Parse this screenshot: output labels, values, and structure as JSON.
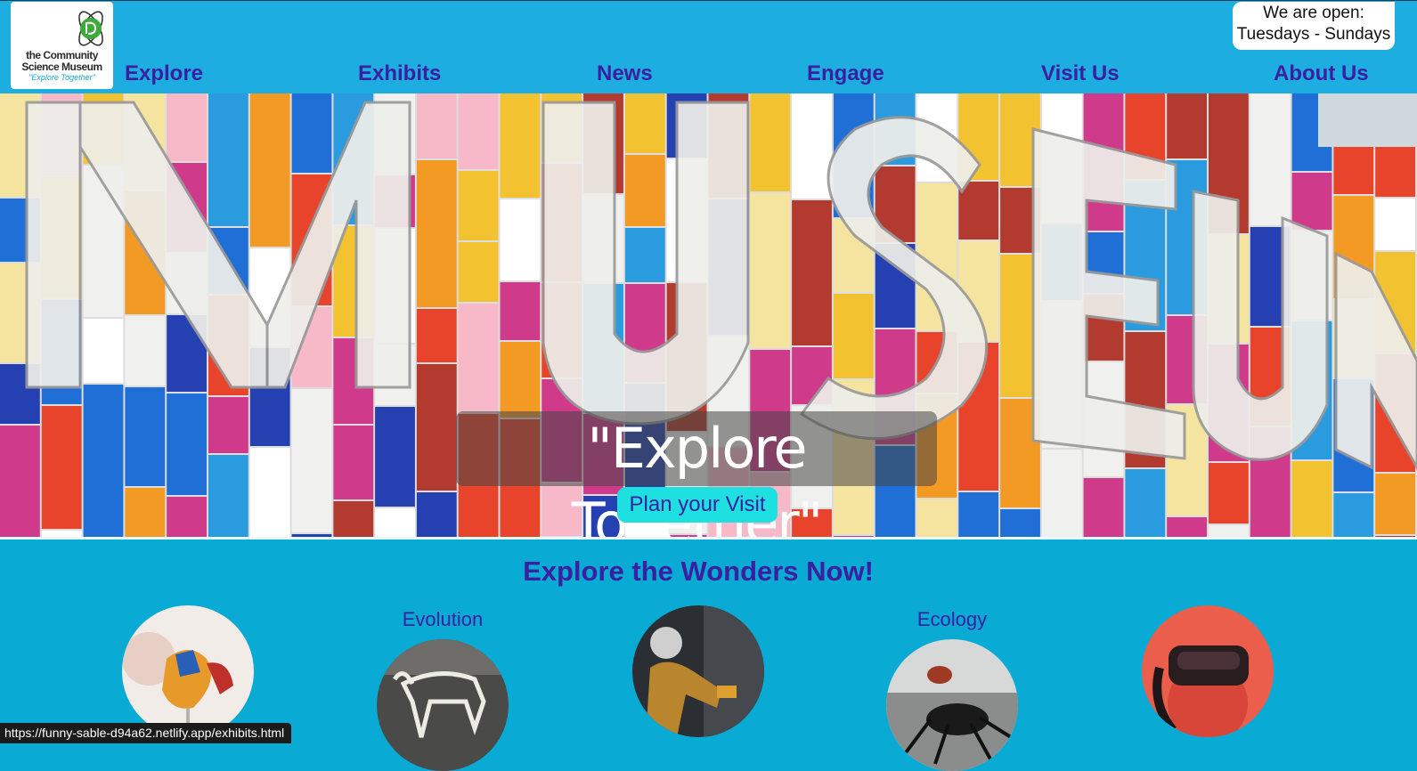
{
  "logo": {
    "line1": "the Community",
    "line2": "Science Museum",
    "tagline": "\"Explore Together\""
  },
  "nav": {
    "items": [
      "Explore",
      "Exhibits",
      "News",
      "Engage",
      "Visit Us",
      "About Us"
    ]
  },
  "hours": {
    "line1": "We are open:",
    "line2": "Tuesdays - Sundays"
  },
  "hero": {
    "title": "\"Explore Together\"",
    "cta": "Plan your Visit"
  },
  "section": {
    "title": "Explore the Wonders Now!",
    "exhibits": [
      {
        "label": ""
      },
      {
        "label": "Evolution"
      },
      {
        "label": ""
      },
      {
        "label": "Ecology"
      },
      {
        "label": ""
      }
    ]
  },
  "status_bar": {
    "url": "https://funny-sable-d94a62.netlify.app/exhibits.html"
  },
  "colors": {
    "header_bg": "#1dade0",
    "page_bg": "#09aad4",
    "nav_text": "#3a1fa0",
    "cta_bg": "#1ee0e0"
  }
}
